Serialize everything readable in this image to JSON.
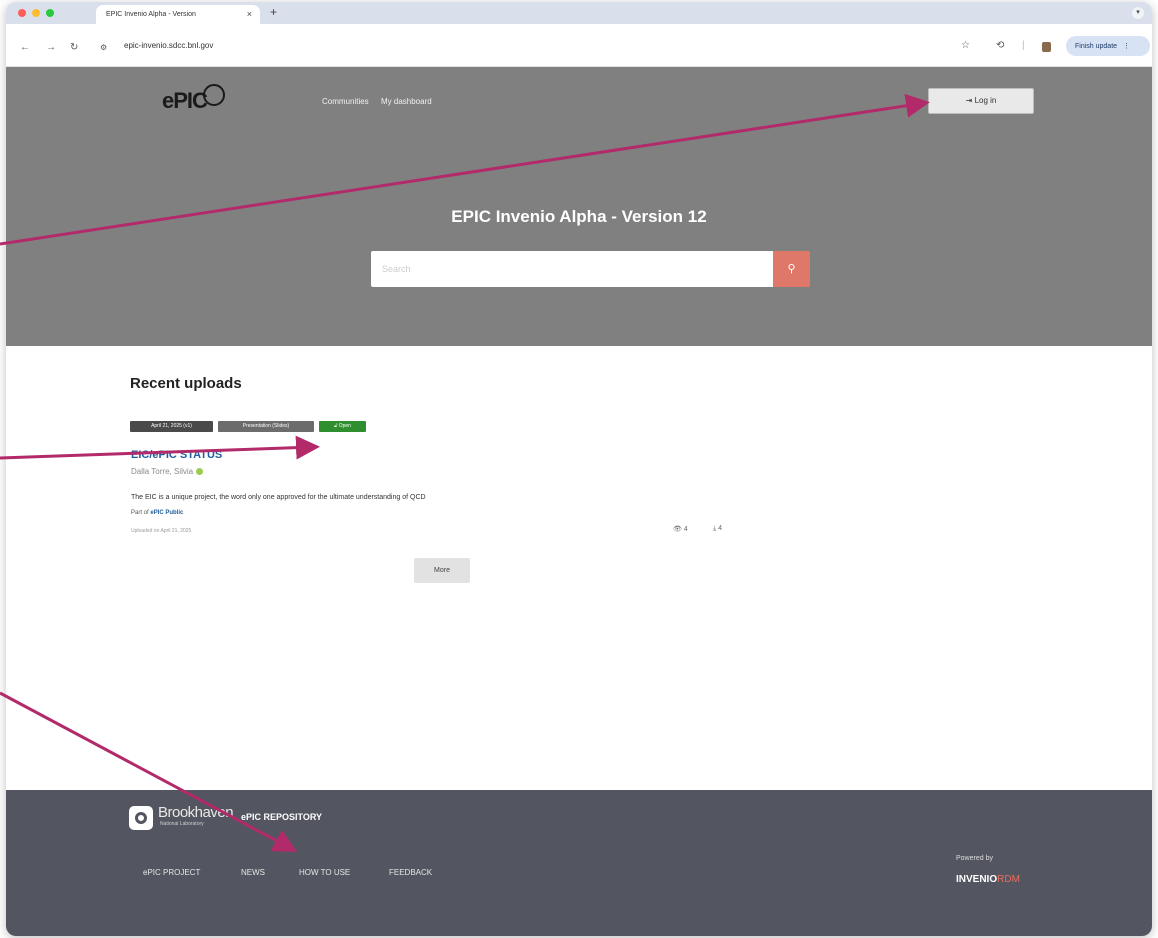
{
  "browser": {
    "tab_title": "EPIC Invenio Alpha - Version",
    "tab_close": "×",
    "new_tab": "+",
    "url": "epic-invenio.sdcc.bnl.gov",
    "finish_update": "Finish update"
  },
  "header": {
    "logo": "ePIC",
    "nav": [
      "Communities",
      "My dashboard"
    ],
    "login_label": "Log in",
    "title": "EPIC Invenio Alpha - Version 12",
    "search_placeholder": "Search"
  },
  "main": {
    "heading": "Recent uploads",
    "record": {
      "badges": [
        "April 21, 2025 (v1)",
        "Presentation (Slides)",
        "Open"
      ],
      "title": "EIC/ePIC STATUS",
      "author": "Dalla Torre, Silvia",
      "description": "The EIC is a unique project, the word only one approved for the ultimate understanding of QCD",
      "part_of_prefix": "Part of",
      "part_of": "ePIC Public",
      "uploaded": "Uploaded on April 21, 2025",
      "views": "4",
      "downloads": "4"
    },
    "more_label": "More"
  },
  "footer": {
    "brand": "Brookhaven",
    "brand_sub": "National Laboratory",
    "repository": "ePIC REPOSITORY",
    "links": [
      "ePIC PROJECT",
      "NEWS",
      "HOW TO USE",
      "FEEDBACK"
    ],
    "powered_by": "Powered by",
    "invenio": "INVENIO",
    "rdm": "RDM"
  },
  "colors": {
    "header_bg": "#808080",
    "footer_bg": "#535660",
    "search_button": "#e0786a",
    "open_badge": "#2f8f2f",
    "arrow": "#b22a6a",
    "link": "#1f5e9c"
  }
}
